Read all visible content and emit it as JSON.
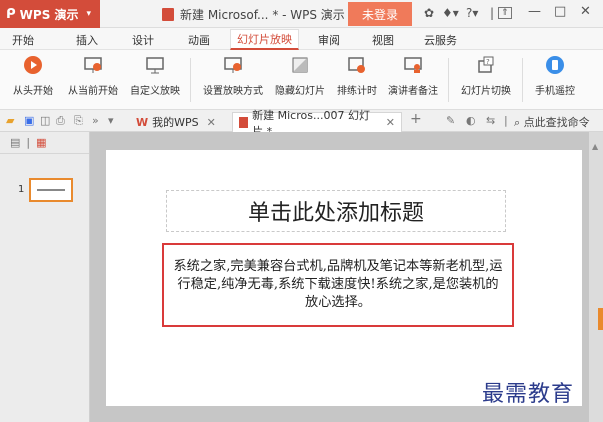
{
  "app": {
    "brand": "WPS 演示",
    "logo_glyph": "ᑭ",
    "doc_title": "新建 Microsof... * - WPS 演示",
    "login_label": "未登录",
    "accent_color": "#d34c3a"
  },
  "menu": {
    "tabs": [
      {
        "label": "开始"
      },
      {
        "label": "插入"
      },
      {
        "label": "设计"
      },
      {
        "label": "动画"
      },
      {
        "label": "幻灯片放映",
        "active": true
      },
      {
        "label": "审阅"
      },
      {
        "label": "视图"
      },
      {
        "label": "云服务"
      }
    ]
  },
  "ribbon": {
    "items": [
      {
        "label": "从头开始",
        "icon": "play-icon"
      },
      {
        "label": "从当前开始",
        "icon": "screen-play-icon"
      },
      {
        "label": "自定义放映",
        "icon": "screen-custom-icon"
      },
      {
        "label": "设置放映方式",
        "icon": "screen-settings-icon"
      },
      {
        "label": "隐藏幻灯片",
        "icon": "hide-slide-icon"
      },
      {
        "label": "排练计时",
        "icon": "timer-icon"
      },
      {
        "label": "演讲者备注",
        "icon": "speaker-notes-icon"
      },
      {
        "label": "幻灯片切换",
        "icon": "slide-transition-icon"
      },
      {
        "label": "手机遥控",
        "icon": "phone-remote-icon"
      }
    ]
  },
  "tabs": {
    "home_tab": "我的WPS",
    "doc_tab": "新建 Micros...007 幻灯片 *",
    "add_glyph": "+",
    "search_label": "点此查找命令"
  },
  "slide": {
    "number": "1",
    "title": "单击此处添加标题",
    "body": "系统之家,完美兼容台式机,品牌机及笔记本等新老机型,运行稳定,纯净无毒,系统下载速度快!系统之家,是您装机的放心选择。"
  },
  "watermark": "最需教育"
}
